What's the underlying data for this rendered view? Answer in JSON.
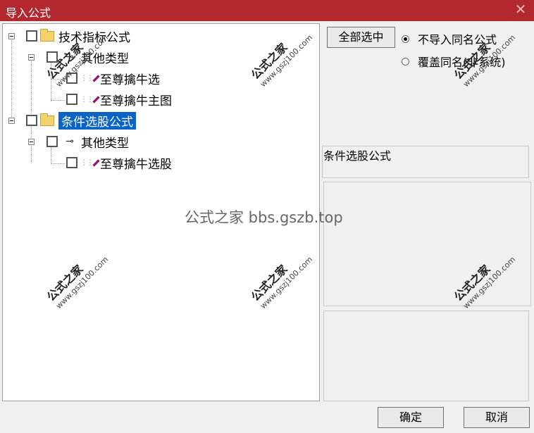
{
  "window": {
    "title": "导入公式",
    "close_glyph": "✕"
  },
  "tree": {
    "group1": {
      "label": "技术指标公式",
      "sub_type": "其他类型",
      "items": [
        "至尊擒牛选",
        "至尊擒牛主图"
      ]
    },
    "group2": {
      "label": "条件选股公式",
      "sub_type": "其他类型",
      "items": [
        "至尊擒牛选股"
      ]
    }
  },
  "side": {
    "select_all": "全部选中",
    "radio_no_import": "不导入同名公式",
    "radio_overwrite": "覆盖同名(非系统)",
    "selected_desc": "条件选股公式"
  },
  "buttons": {
    "ok": "确定",
    "cancel": "取消"
  },
  "watermarks": {
    "center": "公式之家 bbs.gszb.top",
    "stamp_title": "公式之家",
    "stamp_url": "www.gszj100.com"
  },
  "colors": {
    "titlebar": "#b3282e",
    "selection": "#0a64c8",
    "gem": "#c0149c"
  }
}
